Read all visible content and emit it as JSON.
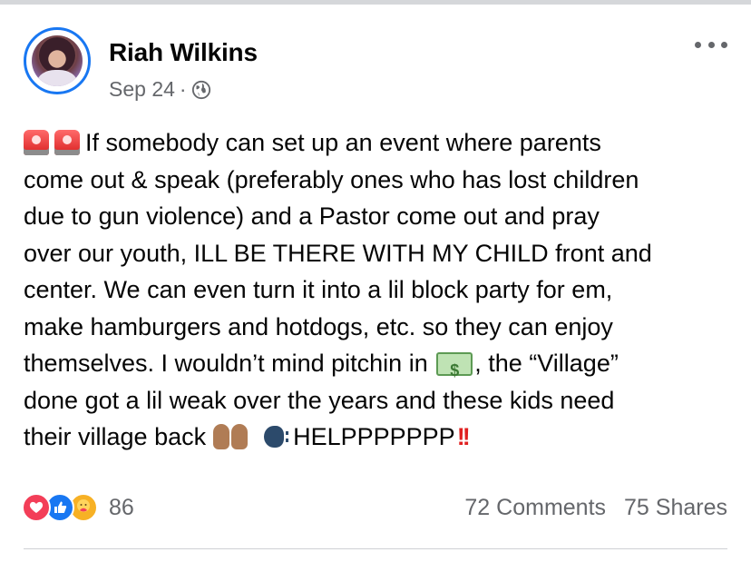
{
  "post": {
    "author": "Riah Wilkins",
    "date": "Sep 24",
    "separator": "·",
    "audience_icon": "globe-icon",
    "more_icon": "more-options-icon",
    "text": {
      "line1": "If somebody can set up an event where parents",
      "line2": "come out & speak (preferably ones who has lost children",
      "line3": "due to gun violence) and a Pastor come out and pray",
      "line4": "over our youth, ILL BE THERE WITH MY CHILD front and",
      "line5": "center. We can even turn it into a lil block party for em,",
      "line6": "make hamburgers and hotdogs, etc. so they can enjoy",
      "line7a": "themselves. I wouldn’t mind pitchin in",
      "line7b": ", the “Village”",
      "line8": "done got a lil weak over the years and these kids need",
      "line9a": "their village back",
      "line9b": "HELPPPPPPP",
      "bangs": "!!"
    },
    "emoji": [
      "police-light-emoji",
      "police-light-emoji",
      "money-emoji",
      "raising-hands-emoji",
      "speaking-head-emoji",
      "double-exclamation-emoji"
    ]
  },
  "footer": {
    "reactions": [
      "love-icon",
      "like-icon",
      "care-icon"
    ],
    "reaction_count": "86",
    "comments": "72 Comments",
    "shares": "75 Shares"
  },
  "colors": {
    "brand_blue": "#1877f2",
    "secondary_text": "#65676b",
    "love": "#f33e58",
    "care": "#f7b125"
  }
}
